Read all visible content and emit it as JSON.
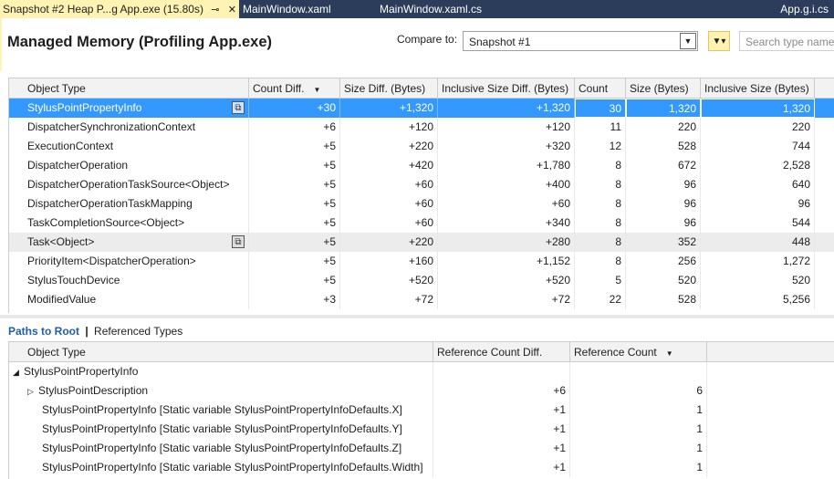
{
  "tabs": [
    {
      "label": "Snapshot #2 Heap P...g App.exe (15.80s)",
      "pin": "⊸",
      "close": "✕"
    },
    {
      "label": "MainWindow.xaml"
    },
    {
      "label": "MainWindow.xaml.cs"
    },
    {
      "label": "App.g.i.cs"
    }
  ],
  "header": {
    "title": "Managed Memory (Profiling App.exe)",
    "compare_label": "Compare to:",
    "compare_value": "Snapshot #1",
    "search_placeholder": "Search type names"
  },
  "types_table": {
    "columns": [
      "Object Type",
      "Count Diff.",
      "Size Diff. (Bytes)",
      "Inclusive Size Diff. (Bytes)",
      "Count",
      "Size (Bytes)",
      "Inclusive Size (Bytes)"
    ],
    "rows": [
      {
        "type": "StylusPointPropertyInfo",
        "count_diff": "+30",
        "size_diff": "+1,320",
        "incl_diff": "+1,320",
        "count": "30",
        "size": "1,320",
        "incl": "1,320"
      },
      {
        "type": "DispatcherSynchronizationContext",
        "count_diff": "+6",
        "size_diff": "+120",
        "incl_diff": "+120",
        "count": "11",
        "size": "220",
        "incl": "220"
      },
      {
        "type": "ExecutionContext",
        "count_diff": "+5",
        "size_diff": "+220",
        "incl_diff": "+320",
        "count": "12",
        "size": "528",
        "incl": "744"
      },
      {
        "type": "DispatcherOperation",
        "count_diff": "+5",
        "size_diff": "+420",
        "incl_diff": "+1,780",
        "count": "8",
        "size": "672",
        "incl": "2,528"
      },
      {
        "type": "DispatcherOperationTaskSource<Object>",
        "count_diff": "+5",
        "size_diff": "+60",
        "incl_diff": "+400",
        "count": "8",
        "size": "96",
        "incl": "640"
      },
      {
        "type": "DispatcherOperationTaskMapping",
        "count_diff": "+5",
        "size_diff": "+60",
        "incl_diff": "+60",
        "count": "8",
        "size": "96",
        "incl": "96"
      },
      {
        "type": "TaskCompletionSource<Object>",
        "count_diff": "+5",
        "size_diff": "+60",
        "incl_diff": "+340",
        "count": "8",
        "size": "96",
        "incl": "544"
      },
      {
        "type": "Task<Object>",
        "count_diff": "+5",
        "size_diff": "+220",
        "incl_diff": "+280",
        "count": "8",
        "size": "352",
        "incl": "448"
      },
      {
        "type": "PriorityItem<DispatcherOperation>",
        "count_diff": "+5",
        "size_diff": "+160",
        "incl_diff": "+1,152",
        "count": "8",
        "size": "256",
        "incl": "1,272"
      },
      {
        "type": "StylusTouchDevice",
        "count_diff": "+5",
        "size_diff": "+520",
        "incl_diff": "+520",
        "count": "5",
        "size": "520",
        "incl": "520"
      },
      {
        "type": "ModifiedValue",
        "count_diff": "+3",
        "size_diff": "+72",
        "incl_diff": "+72",
        "count": "22",
        "size": "528",
        "incl": "5,256"
      }
    ]
  },
  "bottom_tabs": {
    "paths": "Paths to Root",
    "separator": "|",
    "referenced": "Referenced Types"
  },
  "paths_table": {
    "columns": [
      "Object Type",
      "Reference Count Diff.",
      "Reference Count"
    ],
    "rows": [
      {
        "type": "StylusPointPropertyInfo",
        "diff": "",
        "count": "",
        "toggle": "◢"
      },
      {
        "type": "StylusPointDescription",
        "diff": "+6",
        "count": "6",
        "toggle": "▷"
      },
      {
        "type": "StylusPointPropertyInfo [Static variable StylusPointPropertyInfoDefaults.X]",
        "diff": "+1",
        "count": "1",
        "toggle": ""
      },
      {
        "type": "StylusPointPropertyInfo [Static variable StylusPointPropertyInfoDefaults.Y]",
        "diff": "+1",
        "count": "1",
        "toggle": ""
      },
      {
        "type": "StylusPointPropertyInfo [Static variable StylusPointPropertyInfoDefaults.Z]",
        "diff": "+1",
        "count": "1",
        "toggle": ""
      },
      {
        "type": "StylusPointPropertyInfo [Static variable StylusPointPropertyInfoDefaults.Width]",
        "diff": "+1",
        "count": "1",
        "toggle": ""
      }
    ]
  },
  "colors": {
    "active_tab": "#fff3b4",
    "tabbar": "#2b3d5a",
    "selection": "#3399ff",
    "link": "#1e5fa8"
  }
}
